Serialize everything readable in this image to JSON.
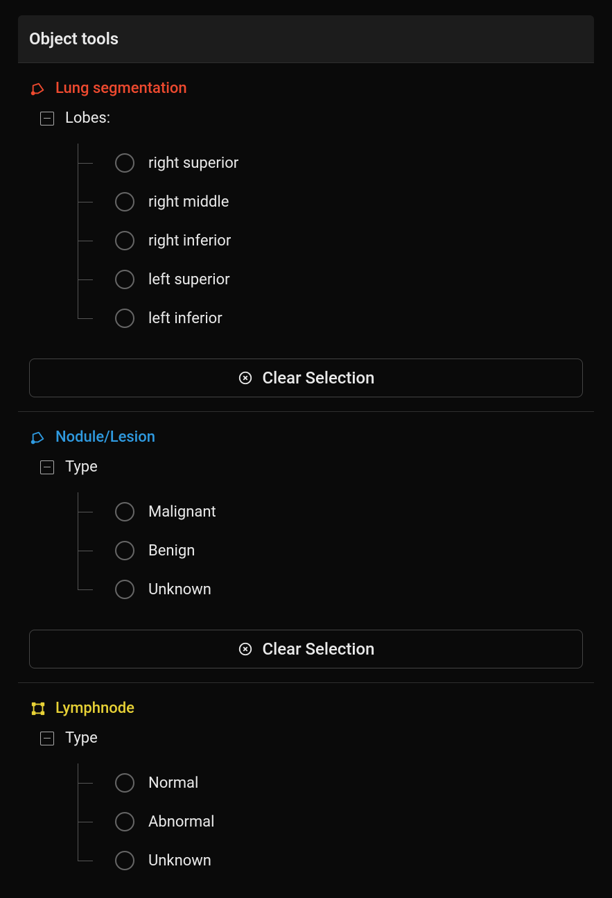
{
  "panel": {
    "title": "Object tools"
  },
  "sections": [
    {
      "title": "Lung segmentation",
      "icon": "polygon-icon",
      "color": "red",
      "group_label": "Lobes:",
      "options": [
        "right superior",
        "right middle",
        "right inferior",
        "left superior",
        "left inferior"
      ],
      "clear_label": "Clear Selection"
    },
    {
      "title": "Nodule/Lesion",
      "icon": "polygon-icon",
      "color": "blue",
      "group_label": "Type",
      "options": [
        "Malignant",
        "Benign",
        "Unknown"
      ],
      "clear_label": "Clear Selection"
    },
    {
      "title": "Lymphnode",
      "icon": "bbox-icon",
      "color": "yellow",
      "group_label": "Type",
      "options": [
        "Normal",
        "Abnormal",
        "Unknown"
      ],
      "clear_label": null
    }
  ]
}
